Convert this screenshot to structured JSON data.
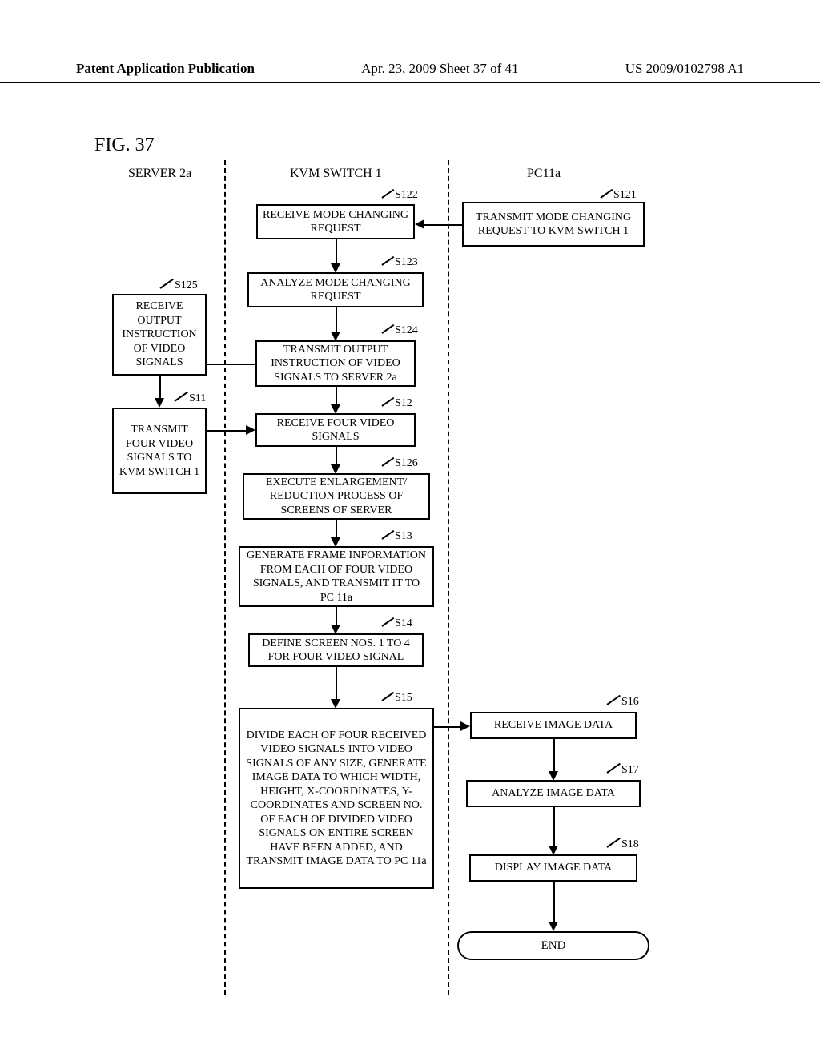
{
  "header": {
    "left": "Patent Application Publication",
    "center": "Apr. 23, 2009  Sheet 37 of 41",
    "right": "US 2009/0102798 A1"
  },
  "figure_label": "FIG. 37",
  "columns": {
    "server": "SERVER 2a",
    "kvm": "KVM SWITCH 1",
    "pc": "PC11a"
  },
  "steps": {
    "s121": {
      "label": "S121",
      "text": "TRANSMIT MODE CHANGING REQUEST TO KVM SWITCH 1"
    },
    "s122": {
      "label": "S122",
      "text": "RECEIVE MODE CHANGING REQUEST"
    },
    "s123": {
      "label": "S123",
      "text": "ANALYZE MODE CHANGING REQUEST"
    },
    "s124": {
      "label": "S124",
      "text": "TRANSMIT OUTPUT INSTRUCTION OF VIDEO SIGNALS TO SERVER 2a"
    },
    "s125": {
      "label": "S125",
      "text": "RECEIVE OUTPUT INSTRUCTION OF VIDEO SIGNALS"
    },
    "s11": {
      "label": "S11",
      "text": "TRANSMIT FOUR VIDEO SIGNALS TO KVM SWITCH 1"
    },
    "s12": {
      "label": "S12",
      "text": "RECEIVE FOUR VIDEO SIGNALS"
    },
    "s126": {
      "label": "S126",
      "text": "EXECUTE ENLARGEMENT/ REDUCTION PROCESS OF SCREENS OF SERVER"
    },
    "s13": {
      "label": "S13",
      "text": "GENERATE FRAME INFORMATION FROM EACH OF FOUR VIDEO SIGNALS, AND TRANSMIT IT TO PC 11a"
    },
    "s14": {
      "label": "S14",
      "text": "DEFINE SCREEN NOS. 1 TO 4 FOR FOUR VIDEO SIGNAL"
    },
    "s15": {
      "label": "S15",
      "text": "DIVIDE EACH OF FOUR RECEIVED VIDEO SIGNALS INTO VIDEO SIGNALS OF ANY SIZE, GENERATE IMAGE DATA TO WHICH WIDTH, HEIGHT, X-COORDINATES, Y-COORDINATES AND SCREEN NO. OF EACH OF DIVIDED VIDEO SIGNALS ON ENTIRE SCREEN HAVE BEEN ADDED, AND TRANSMIT IMAGE DATA TO PC 11a"
    },
    "s16": {
      "label": "S16",
      "text": "RECEIVE IMAGE DATA"
    },
    "s17": {
      "label": "S17",
      "text": "ANALYZE IMAGE DATA"
    },
    "s18": {
      "label": "S18",
      "text": "DISPLAY IMAGE DATA"
    }
  },
  "end": "END"
}
